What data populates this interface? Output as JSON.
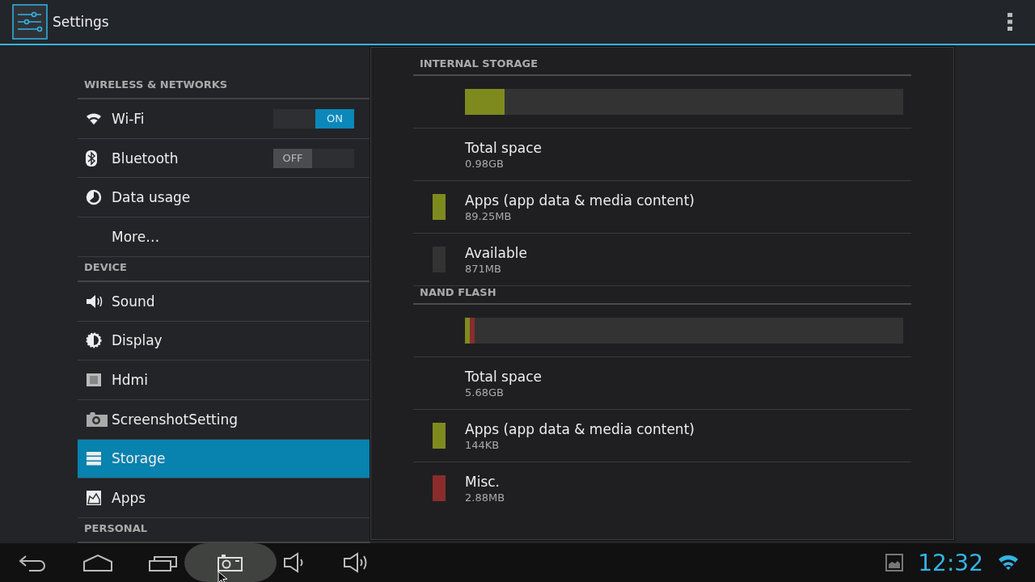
{
  "action_bar": {
    "title": "Settings"
  },
  "sidebar": {
    "groups": [
      {
        "header": "WIRELESS & NETWORKS",
        "items": [
          {
            "label": "Wi-Fi",
            "selected": false,
            "toggle": {
              "label": "ON",
              "on": true
            }
          },
          {
            "label": "Bluetooth",
            "selected": false,
            "toggle": {
              "label": "OFF",
              "on": false
            }
          },
          {
            "label": "Data usage",
            "selected": false
          },
          {
            "label": "More…",
            "selected": false
          }
        ]
      },
      {
        "header": "DEVICE",
        "items": [
          {
            "label": "Sound",
            "selected": false
          },
          {
            "label": "Display",
            "selected": false
          },
          {
            "label": "Hdmi",
            "selected": false
          },
          {
            "label": "ScreenshotSetting",
            "selected": false
          },
          {
            "label": "Storage",
            "selected": true
          },
          {
            "label": "Apps",
            "selected": false
          }
        ]
      },
      {
        "header": "PERSONAL"
      }
    ]
  },
  "storage": [
    {
      "title": "INTERNAL STORAGE",
      "bar": [
        {
          "color": "#7f8a1e",
          "level": 0.09
        }
      ],
      "rows": [
        {
          "label": "Total space",
          "value": "0.98GB"
        },
        {
          "label": "Apps (app data & media content)",
          "value": "89.25MB",
          "color": "#7f8a1e"
        },
        {
          "label": "Available",
          "value": "871MB",
          "color": "#333333"
        }
      ]
    },
    {
      "title": "NAND FLASH",
      "bar": [
        {
          "color": "#7f8a1e",
          "level": 0.011
        },
        {
          "color": "#8a2c2c",
          "level": 0.011
        }
      ],
      "rows": [
        {
          "label": "Total space",
          "value": "5.68GB"
        },
        {
          "label": "Apps (app data & media content)",
          "value": "144KB",
          "color": "#7f8a1e"
        },
        {
          "label": "Misc.",
          "value": "2.88MB",
          "color": "#8a2c2c"
        }
      ]
    }
  ],
  "status_bar": {
    "time": "12:32"
  }
}
